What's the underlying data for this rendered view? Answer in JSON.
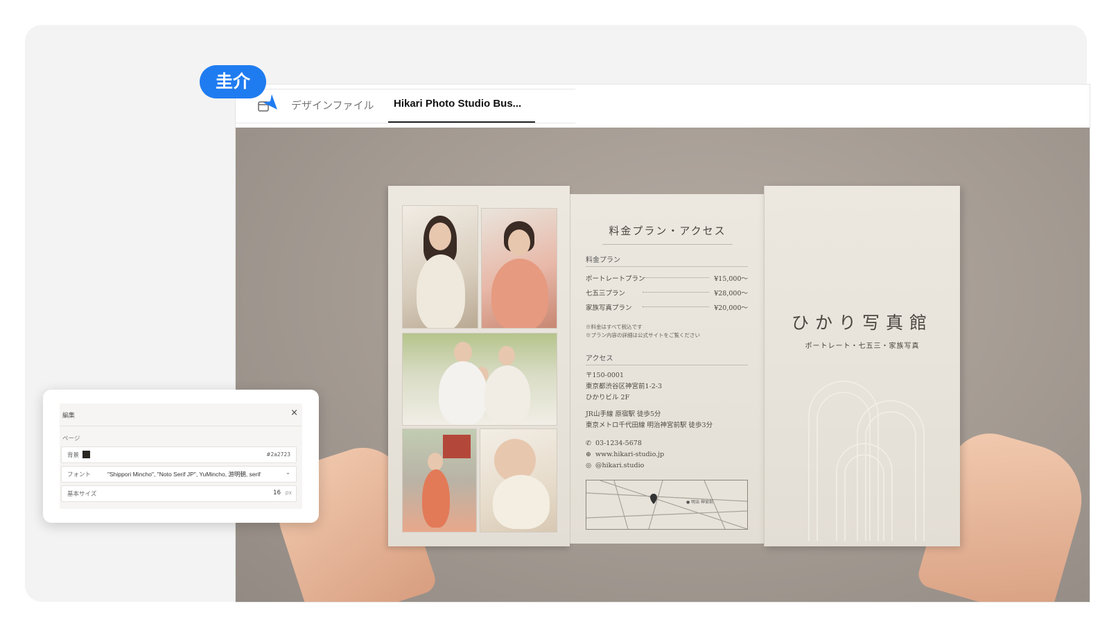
{
  "tabs": {
    "design_label": "デザインファイル",
    "active_label": "Hikari Photo Studio Bus..."
  },
  "collaborator": {
    "name": "圭介",
    "color": "#1f7cf0"
  },
  "brochure": {
    "middle": {
      "title": "料金プラン・アクセス",
      "plans_heading": "料金プラン",
      "plans": [
        {
          "name": "ポートレートプラン",
          "price": "¥15,000〜"
        },
        {
          "name": "七五三プラン",
          "price": "¥28,000〜"
        },
        {
          "name": "家族写真プラン",
          "price": "¥20,000〜"
        }
      ],
      "notes": [
        "※料金はすべて税込です",
        "※プラン内容の詳細は公式サイトをご覧ください"
      ],
      "access_heading": "アクセス",
      "address": [
        "〒150-0001",
        "東京都渋谷区神宮前1-2-3",
        "ひかりビル 2F"
      ],
      "stations": [
        "JR山手線 原宿駅 徒歩5分",
        "東京メトロ千代田線 明治神宮前駅 徒歩3分"
      ],
      "phone": "03-1234-5678",
      "website": "www.hikari-studio.jp",
      "instagram": "@hikari.studio",
      "map_label": "● 明治 神宮前"
    },
    "right": {
      "title": "ひかり写真館",
      "subtitle": "ポートレート・七五三・家族写真"
    }
  },
  "editor": {
    "title": "編集",
    "close_label": "×",
    "section": "ページ",
    "background_label": "背景",
    "background_value": "#2a2723",
    "font_label": "フォント",
    "font_value": "\"Shippori Mincho\", \"Noto Serif JP\", YuMincho, 游明朝, serif",
    "size_label": "基本サイズ",
    "size_value": "16",
    "size_unit": "px"
  }
}
